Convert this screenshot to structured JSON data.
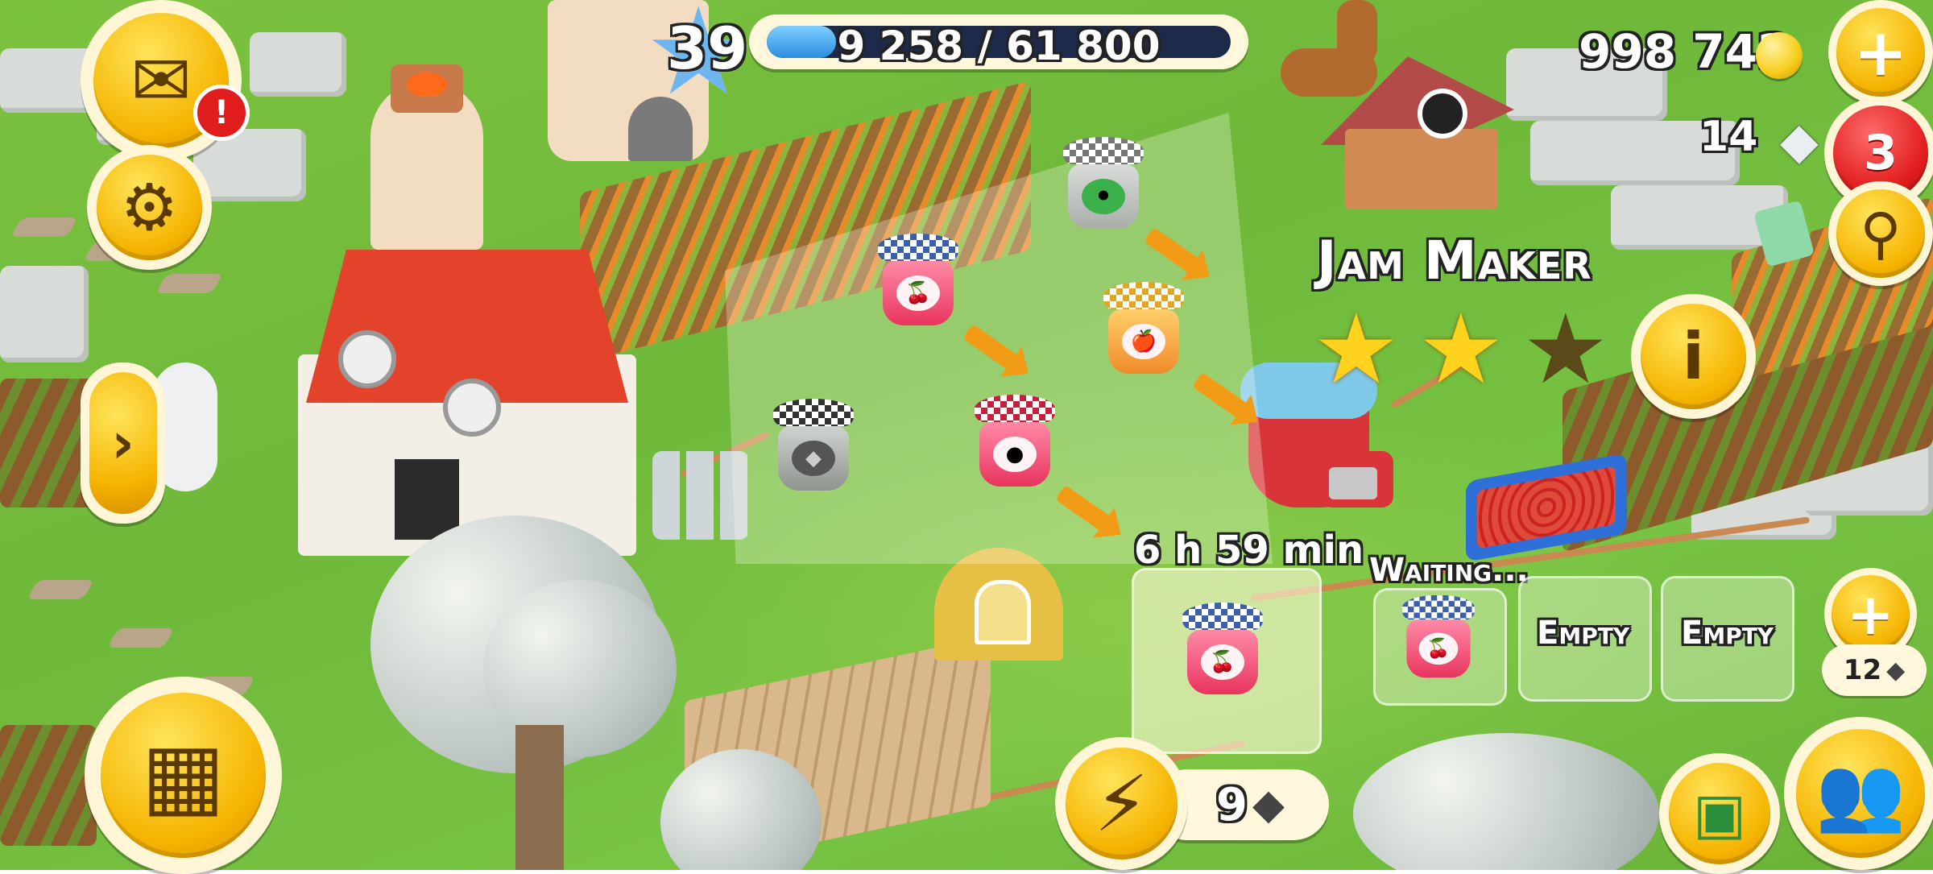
{
  "hud": {
    "level": "39",
    "xp_text": "9 258 / 61 800",
    "xp_progress": 0.15,
    "coins": "998 742",
    "diamonds": "14",
    "notifications_badge": "3",
    "mail_alert": "!"
  },
  "machine": {
    "name": "Jam Maker",
    "stars_filled": 2,
    "stars_total": 3,
    "timer": "6 h 59 min",
    "skip_cost": "9",
    "queue": [
      {
        "status": "Waiting...",
        "item": "cherry-jam"
      },
      {
        "status": "Empty"
      },
      {
        "status": "Empty"
      }
    ],
    "unlock_slot_cost": "12"
  },
  "recipes": [
    {
      "name": "cherry-jam",
      "color": "#e8345e"
    },
    {
      "name": "blackberry-jam",
      "color": "#3a2a48"
    },
    {
      "name": "apple-jam",
      "color": "#f08a2a"
    },
    {
      "name": "raspberry-jam",
      "color": "#e8345e"
    },
    {
      "name": "strawberry-jam",
      "color": "#3a3a3a"
    }
  ],
  "colors": {
    "button_gold": "#f5b400",
    "badge_red": "#e01c1c",
    "xp_fill": "#2b8ee0",
    "grass": "#7cc23f"
  }
}
